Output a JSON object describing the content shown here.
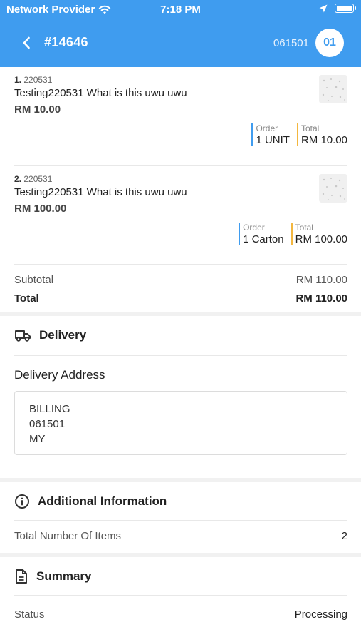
{
  "status_bar": {
    "carrier": "Network Provider",
    "time": "7:18 PM"
  },
  "nav": {
    "title": "#14646",
    "code": "061501",
    "badge": "01"
  },
  "items": [
    {
      "index": "1.",
      "sku": "220531",
      "name": "Testing220531 What is this uwu uwu",
      "price": "RM 10.00",
      "order_label": "Order",
      "order_value": "1 UNIT",
      "total_label": "Total",
      "total_value": "RM 10.00"
    },
    {
      "index": "2.",
      "sku": "220531",
      "name": "Testing220531 What is this uwu uwu",
      "price": "RM 100.00",
      "order_label": "Order",
      "order_value": "1 Carton",
      "total_label": "Total",
      "total_value": "RM 100.00"
    }
  ],
  "totals": {
    "subtotal_label": "Subtotal",
    "subtotal_value": "RM 110.00",
    "total_label": "Total",
    "total_value": "RM 110.00"
  },
  "delivery": {
    "title": "Delivery",
    "address_label": "Delivery Address",
    "address_lines": [
      "BILLING",
      "061501",
      "MY"
    ]
  },
  "additional": {
    "title": "Additional Information",
    "items_label": "Total Number Of Items",
    "items_value": "2"
  },
  "summary": {
    "title": "Summary",
    "status_label": "Status",
    "status_value": "Processing"
  },
  "colors": {
    "header": "#3f9cef",
    "order_accent": "#3f9cef",
    "total_accent": "#f3b73f"
  }
}
